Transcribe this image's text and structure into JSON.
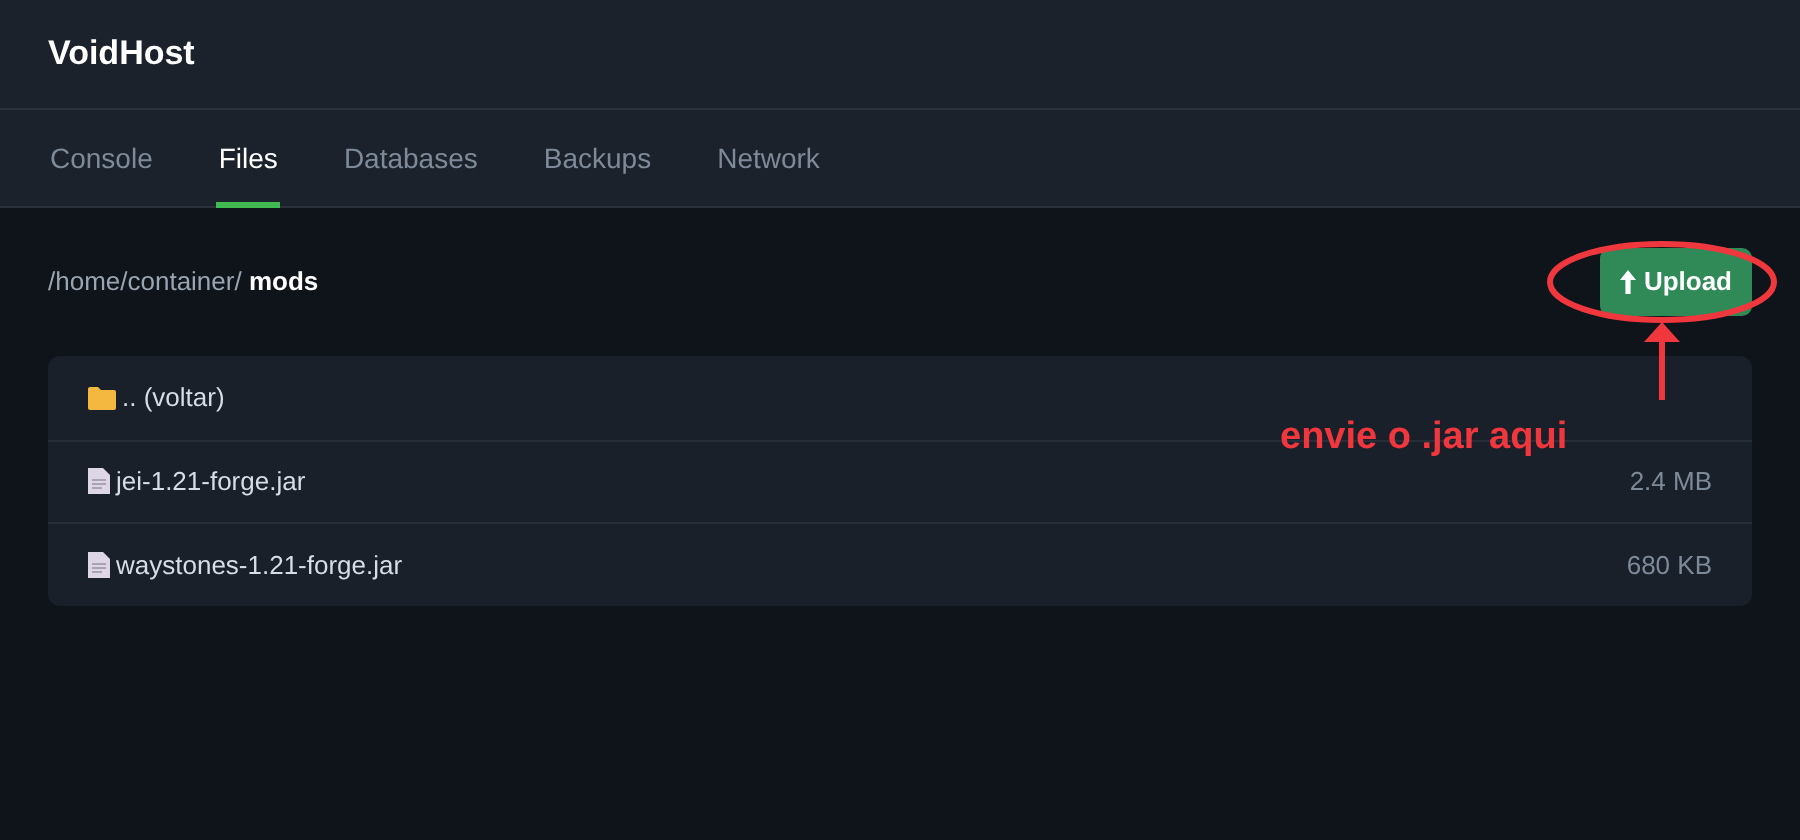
{
  "app": {
    "title": "VoidHost"
  },
  "tabs": [
    {
      "label": "Console",
      "selected": false
    },
    {
      "label": "Files",
      "selected": true
    },
    {
      "label": "Databases",
      "selected": false
    },
    {
      "label": "Backups",
      "selected": false
    },
    {
      "label": "Network",
      "selected": false
    }
  ],
  "path": {
    "parent": "/home/container/",
    "current": "mods"
  },
  "upload_button": {
    "label": "Upload"
  },
  "files": [
    {
      "kind": "folder",
      "name": ".. (voltar)"
    },
    {
      "kind": "file",
      "name": "jei-1.21-forge.jar",
      "size": "2.4 MB"
    },
    {
      "kind": "file",
      "name": "waystones-1.21-forge.jar",
      "size": "680 KB"
    }
  ],
  "annotation": {
    "text": "envie o .jar aqui"
  }
}
